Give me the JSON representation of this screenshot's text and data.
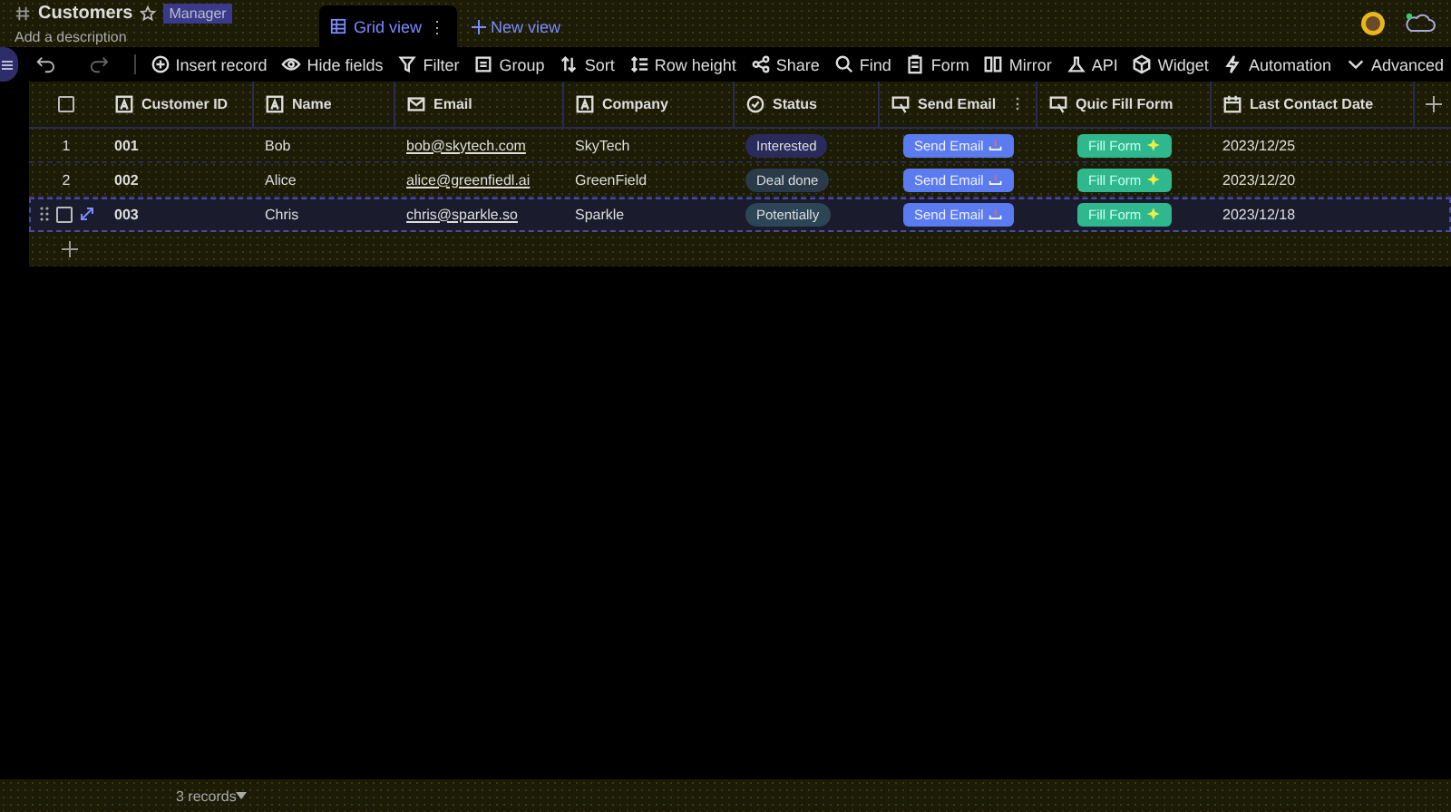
{
  "header": {
    "title": "Customers",
    "role": "Manager",
    "description": "Add a description"
  },
  "views": [
    {
      "label": "Grid view",
      "selected": true,
      "menu": "⋮"
    }
  ],
  "new_view": "New view",
  "toolbar_left": [
    "Insert record",
    "Hide fields",
    "Filter",
    "Group",
    "Sort",
    "Row height",
    "Share"
  ],
  "toolbar_right": [
    "Find",
    "Form",
    "Mirror",
    "API",
    "Widget",
    "Automation",
    "Advanced"
  ],
  "table": {
    "all_checked": false,
    "columns": [
      {
        "label": "Customer ID"
      },
      {
        "label": "Name"
      },
      {
        "label": "Email"
      },
      {
        "label": "Company"
      },
      {
        "label": "Status"
      },
      {
        "label": "Send Email",
        "menu": "⋮"
      },
      {
        "label": "Quic Fill Form"
      },
      {
        "label": "Last Contact Date"
      }
    ],
    "rows": [
      {
        "number": "1",
        "hovered": false,
        "id": "001",
        "name": "Bob",
        "email": "bob@skytech.com",
        "company": "SkyTech",
        "status": {
          "label": "Interested",
          "color": "#2a2a5c"
        },
        "send": "Send Email",
        "fill": "Fill Form",
        "date": "2023/12/25"
      },
      {
        "number": "2",
        "hovered": false,
        "id": "002",
        "name": "Alice",
        "email": "alice@greenfiedl.ai",
        "company": "GreenField",
        "status": {
          "label": "Deal done",
          "color": "#2a3a48"
        },
        "send": "Send Email",
        "fill": "Fill Form",
        "date": "2023/12/20"
      },
      {
        "hovered": true,
        "id": "003",
        "name": "Chris",
        "email": "chris@sparkle.so",
        "company": "Sparkle",
        "status": {
          "label": "Potentially",
          "color": "#2c4656"
        },
        "send": "Send Email",
        "fill": "Fill Form",
        "date": "2023/12/18"
      }
    ]
  },
  "footer": {
    "count": "3 records"
  }
}
